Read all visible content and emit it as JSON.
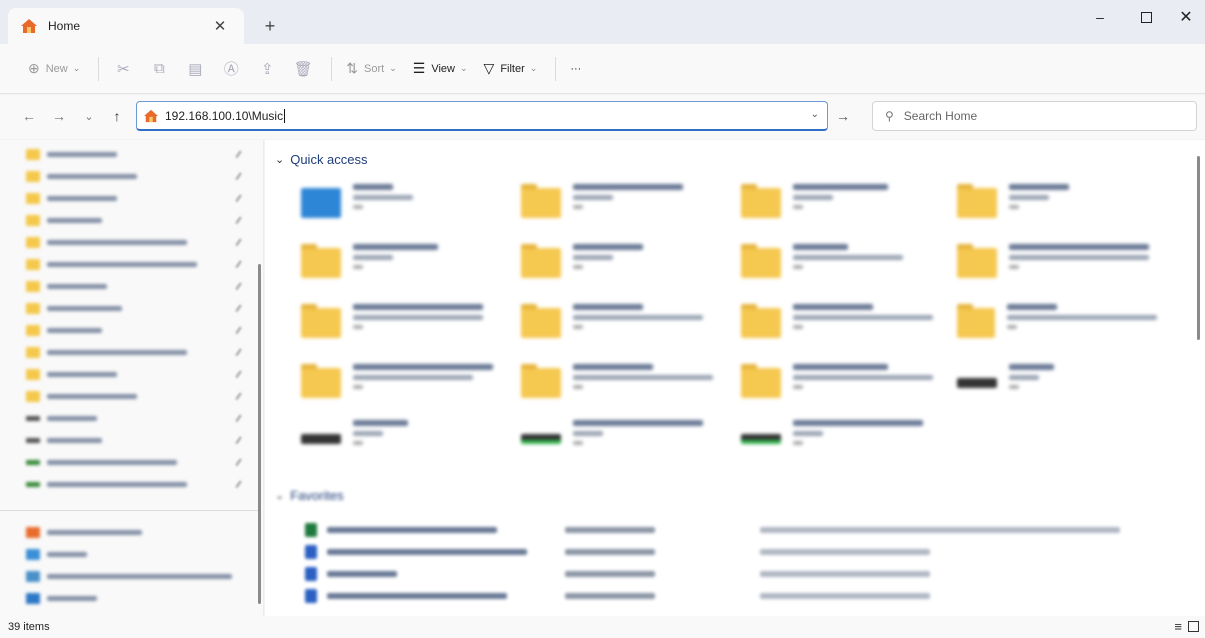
{
  "window": {
    "tab_title": "Home",
    "tab_close": "✕",
    "new_tab": "+",
    "min": "–",
    "close": "✕"
  },
  "toolbar": {
    "new_label": "New",
    "sort_label": "Sort",
    "view_label": "View",
    "filter_label": "Filter",
    "more_label": "···"
  },
  "address": {
    "path": "192.168.100.10\\Music",
    "search_placeholder": "Search Home"
  },
  "nav": {
    "back": "←",
    "forward": "→",
    "recent": "⌄",
    "up": "↑",
    "go": "→"
  },
  "main": {
    "quick_access_label": "Quick access",
    "favorites_label": "Favorites"
  },
  "status": {
    "item_count": "39 items"
  },
  "colors": {
    "accent": "#2f6ec4",
    "folder": "#f5c850",
    "home_icon": "#e8692a"
  }
}
